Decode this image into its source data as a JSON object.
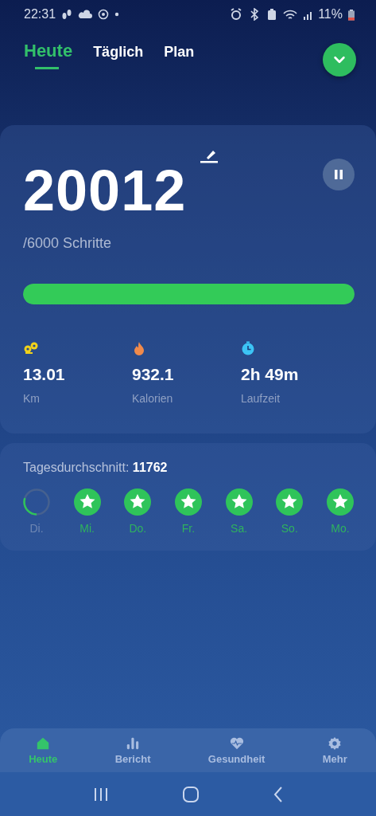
{
  "status_bar": {
    "time": "22:31",
    "battery": "11%"
  },
  "tabs": [
    {
      "label": "Heute",
      "selected": true
    },
    {
      "label": "Täglich",
      "selected": false
    },
    {
      "label": "Plan",
      "selected": false
    }
  ],
  "steps_card": {
    "steps": "20012",
    "goal": "/6000 Schritte",
    "paused": false,
    "level": 1,
    "stats": [
      {
        "kind": "distance",
        "value": "13.01",
        "label": "Km"
      },
      {
        "kind": "calories",
        "value": "932.1",
        "label": "Kalorien"
      },
      {
        "kind": "time",
        "value": "2h 49m",
        "label": "Laufzeit"
      }
    ]
  },
  "average_card": {
    "label": "Tagesdurchschnitt: ",
    "value": "11762",
    "days": [
      {
        "label": "Di.",
        "achieved": false
      },
      {
        "label": "Mi.",
        "achieved": true
      },
      {
        "label": "Do.",
        "achieved": true
      },
      {
        "label": "Fr.",
        "achieved": true
      },
      {
        "label": "Sa.",
        "achieved": true
      },
      {
        "label": "So.",
        "achieved": true
      },
      {
        "label": "Mo.",
        "achieved": true
      }
    ]
  },
  "bottom_nav": [
    {
      "kind": "home",
      "label": "Heute",
      "selected": true
    },
    {
      "kind": "report",
      "label": "Bericht",
      "selected": false
    },
    {
      "kind": "health",
      "label": "Gesundheit",
      "selected": false
    },
    {
      "kind": "more",
      "label": "Mehr",
      "selected": false
    }
  ]
}
